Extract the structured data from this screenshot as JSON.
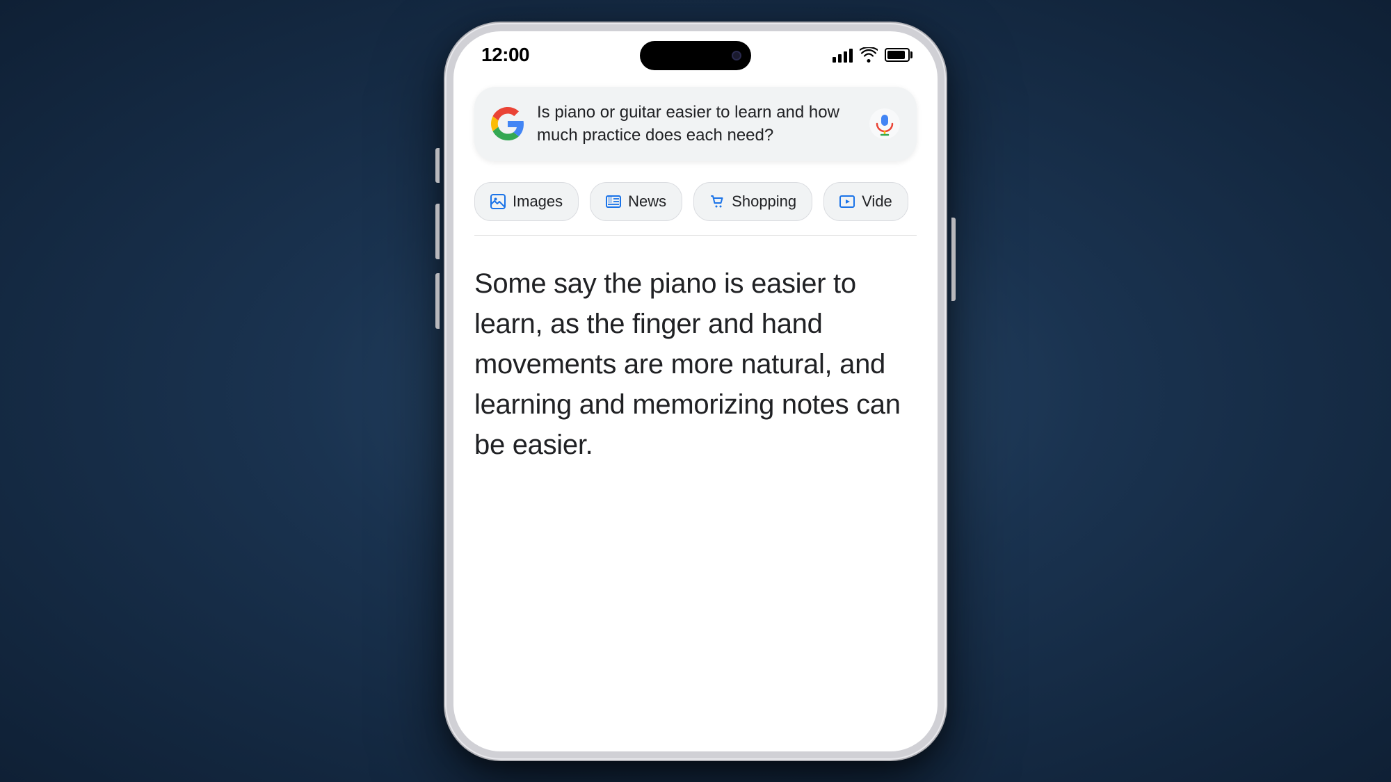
{
  "status_bar": {
    "time": "12:00",
    "signal_bars": [
      8,
      12,
      16,
      20
    ],
    "battery_label": "battery"
  },
  "search": {
    "query": "Is piano or guitar easier to learn and how much practice does each need?",
    "google_logo_label": "Google",
    "mic_label": "microphone"
  },
  "filters": [
    {
      "id": "images",
      "label": "Images",
      "icon": "🖼"
    },
    {
      "id": "news",
      "label": "News",
      "icon": "📰"
    },
    {
      "id": "shopping",
      "label": "Shopping",
      "icon": "🏷"
    },
    {
      "id": "videos",
      "label": "Vide",
      "icon": "▶"
    }
  ],
  "answer": {
    "text": "Some say the piano is easier to learn, as the finger and hand movements are more natural, and learning and memorizing notes can be easier."
  }
}
